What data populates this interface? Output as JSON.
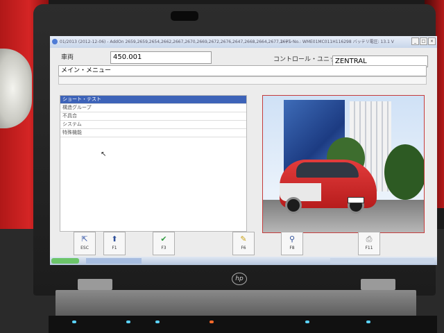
{
  "titlebar": {
    "title": "01/2013 (2012-12-06) - AddOn",
    "info": "2659,2659,2654,2662,2667,2670,2669,2672,2676,2647,2668,2664,2677,2675",
    "vin": "シャシNo.: WME01MC011H116298",
    "battery": "バッテリ電圧: 13.1 V"
  },
  "vehicle": {
    "label": "車両",
    "value": "450.001"
  },
  "control_unit": {
    "label": "コントロール・ユニット",
    "value": "ZENTRAL"
  },
  "main_menu": {
    "title": "メイン・メニュー"
  },
  "menu_items": [
    "ショート・テスト",
    "構造グループ",
    "不具合",
    "システム",
    "特殊機能"
  ],
  "fkeys": [
    {
      "icon": "exit-icon",
      "label": "ESC",
      "glyph": "⇱",
      "color": "#3a5aa8"
    },
    {
      "icon": "up-arrow-icon",
      "label": "F1",
      "glyph": "⬆",
      "color": "#2e4f99"
    },
    {
      "icon": "check-icon",
      "label": "F3",
      "glyph": "✔",
      "color": "#2f9a3f"
    },
    {
      "icon": "search-key-icon",
      "label": "F6",
      "glyph": "✎",
      "color": "#c9a21a"
    },
    {
      "icon": "magnifier-icon",
      "label": "F8",
      "glyph": "⚲",
      "color": "#2e4f99"
    },
    {
      "icon": "print-icon",
      "label": "F11",
      "glyph": "⎙",
      "color": "#777777"
    }
  ],
  "photo": {
    "description": "red smart car",
    "plate": "HB-S 2290"
  },
  "brand": {
    "laptop": "hp"
  }
}
